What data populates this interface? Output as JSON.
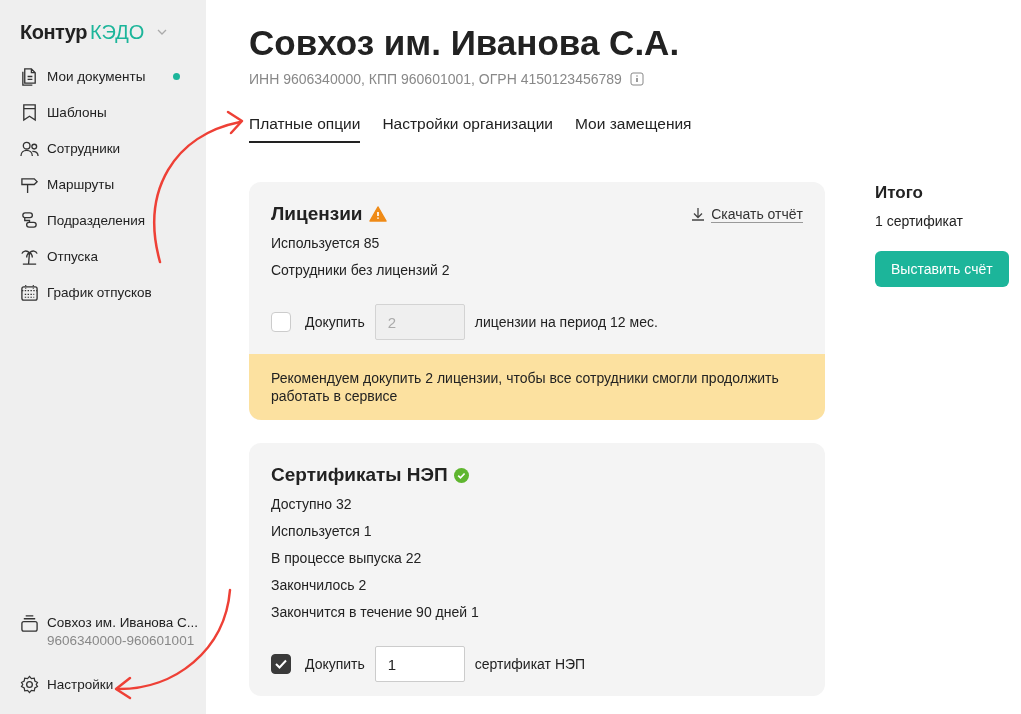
{
  "sidebar": {
    "logo": {
      "brand": "Контур",
      "product": "КЭДО"
    },
    "items": [
      {
        "label": "Мои документы",
        "kind": "document",
        "unread": true
      },
      {
        "label": "Шаблоны",
        "kind": "bookmark",
        "unread": false
      },
      {
        "label": "Сотрудники",
        "kind": "people",
        "unread": false
      },
      {
        "label": "Маршруты",
        "kind": "signpost",
        "unread": false
      },
      {
        "label": "Подразделения",
        "kind": "structure",
        "unread": false
      },
      {
        "label": "Отпуска",
        "kind": "palm",
        "unread": false
      },
      {
        "label": "График отпусков",
        "kind": "calendar",
        "unread": false
      }
    ],
    "organization": {
      "name": "Совхоз им. Иванова С...",
      "codes": "9606340000-960601001"
    },
    "settings": {
      "label": "Настройки"
    }
  },
  "header": {
    "title": "Совхоз им. Иванова С.А.",
    "details": "ИНН 9606340000, КПП 960601001, ОГРН 4150123456789"
  },
  "tabs": [
    {
      "label": "Платные опции",
      "selected": true
    },
    {
      "label": "Настройки организации",
      "selected": false
    },
    {
      "label": "Мои замещения",
      "selected": false
    }
  ],
  "cards": [
    {
      "title": "Лицензии",
      "kind": "warning",
      "download_link": "Скачать отчёт",
      "stats": [
        "Используется 85",
        "Сотрудники без лицензий 2"
      ],
      "purchase": {
        "checked": false,
        "label": "Докупить",
        "value": "2",
        "disabled": true,
        "suffix": "лицензии на период 12 мес."
      },
      "notice": "Рекомендуем докупить 2 лицензии, чтобы все сотрудники смогли продолжить работать в сервисе"
    },
    {
      "title": "Сертификаты НЭП",
      "kind": "ok",
      "stats": [
        "Доступно 32",
        "Используется 1",
        "В процессе выпуска 22",
        "Закончилось 2",
        "Закончится в течение 90 дней 1"
      ],
      "purchase": {
        "checked": true,
        "label": "Докупить",
        "value": "1",
        "disabled": false,
        "suffix": "сертификат НЭП"
      }
    }
  ],
  "summary": {
    "title": "Итого",
    "text": "1 сертификат",
    "button": "Выставить счёт"
  }
}
